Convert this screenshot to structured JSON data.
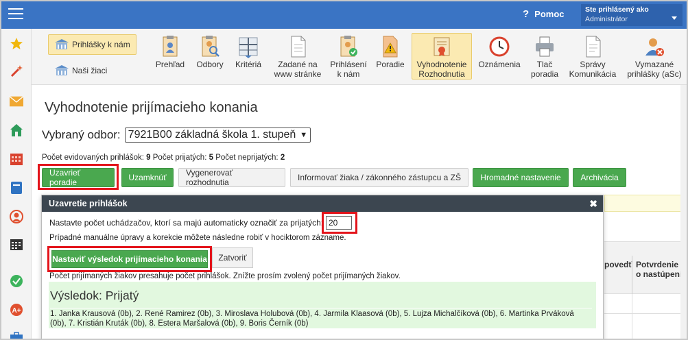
{
  "topbar": {
    "help_label": "Pomoc",
    "user_line1": "Ste prihlásený ako",
    "user_line2": "Administrátor"
  },
  "sidebar": {
    "icons": [
      "star-icon",
      "magic-wand-icon",
      "envelope-icon",
      "home-icon",
      "calendar-grid-icon",
      "book-icon",
      "person-icon",
      "timetable-icon",
      "check-circle-icon",
      "grade-a-plus-icon",
      "briefcase-icon"
    ]
  },
  "toolbar": {
    "left_items": [
      {
        "label": "Prihlášky k nám",
        "icon": "school-building-icon",
        "active": true
      },
      {
        "label": "Naši žiaci",
        "icon": "school-building-icon",
        "active": false
      }
    ],
    "items": [
      {
        "label": "Prehľad",
        "icon": "clipboard-person-icon"
      },
      {
        "label": "Odbory",
        "icon": "clipboard-search-icon"
      },
      {
        "label": "Kritériá",
        "icon": "scales-icon"
      },
      {
        "label": "Zadané na www stránke",
        "icon": "document-icon"
      },
      {
        "label": "Prihlásení k nám",
        "icon": "clipboard-check-icon"
      },
      {
        "label": "Poradie",
        "icon": "warning-document-icon"
      },
      {
        "label": "Vyhodnotenie Rozhodnutia",
        "icon": "certificate-icon",
        "active": true
      },
      {
        "label": "Oznámenia",
        "icon": "clock-icon"
      },
      {
        "label": "Tlač poradia",
        "icon": "printer-icon"
      },
      {
        "label": "Správy Komunikácia",
        "icon": "message-document-icon"
      },
      {
        "label": "Vymazané prihlášky (aSc)",
        "icon": "deleted-user-icon"
      }
    ]
  },
  "main": {
    "title": "Vyhodnotenie prijímacieho konania",
    "select_label": "Vybraný odbor:",
    "select_value": "7921B00 základná škola 1. stupeň",
    "counts": {
      "registered_label": "Počet evidovaných prihlášok:",
      "registered_value": "9",
      "accepted_label": "Počet prijatých:",
      "accepted_value": "5",
      "rejected_label": "Počet neprijatých:",
      "rejected_value": "2"
    },
    "buttons": {
      "close_order": "Uzavrieť poradie",
      "lock": "Uzamknúť",
      "generate": "Vygenerovať rozhodnutia",
      "inform": "Informovať žiaka / zákonného zástupcu a ZŠ",
      "bulk": "Hromadné nastavenie",
      "archive": "Archivácia"
    },
    "table": {
      "col_response": "povedť",
      "col_confirm": "Potvrdenie o nastúpení"
    }
  },
  "dialog": {
    "title": "Uzavretie prihlášok",
    "close_symbol": "✖",
    "line1": "Nastavte počet uchádzačov, ktorí sa majú automaticky označiť za prijatých:",
    "input_value": "20",
    "line2": "Prípadné manuálne úpravy a korekcie môžete následne robiť v hociktorom zázname.",
    "set_result_button": "Nastaviť výsledok prijímacieho konania",
    "close_button": "Zatvoriť",
    "warning": "Počet prijímaných žiakov presahuje počet prihlášok. Znížte prosím zvolený počet prijímaných žiakov.",
    "result_title": "Výsledok: Prijatý",
    "result_list": "1. Janka Krausová (0b), 2. René Ramirez (0b), 3. Miroslava Holubová (0b), 4. Jarmila Klaasová (0b), 5. Lujza Michalčíková (0b), 6. Martinka Prváková (0b), 7. Kristián Kruták (0b), 8. Estera Maršalová (0b), 9. Boris Černík (0b)"
  }
}
